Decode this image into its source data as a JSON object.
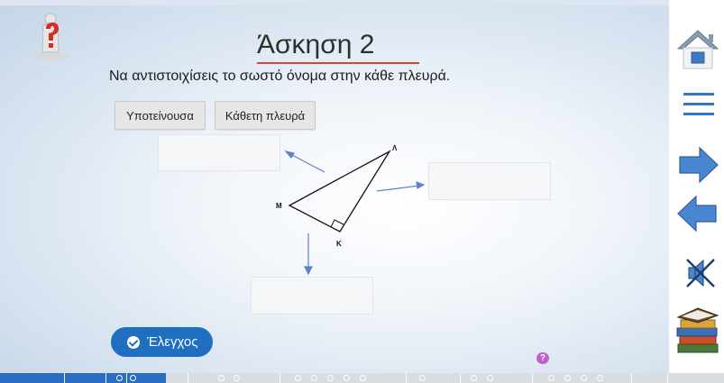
{
  "exercise": {
    "title": "Άσκηση 2",
    "instruction": "Να αντιστοιχίσεις το σωστό όνομα στην κάθε πλευρά."
  },
  "tiles": [
    {
      "label": "Υποτείνουσα"
    },
    {
      "label": "Κάθετη πλευρά"
    }
  ],
  "triangle": {
    "vertex_top": "Λ",
    "vertex_left": "Μ",
    "vertex_bottom": "Κ"
  },
  "check_button": {
    "label": "Έλεγχος"
  },
  "help_bubble": "?",
  "sidebar": [
    "home-icon",
    "menu-icon",
    "next-arrow-icon",
    "prev-arrow-icon",
    "mute-speaker-icon",
    "books-icon"
  ],
  "colors": {
    "accent": "#1e6fbf",
    "title_underline": "#d9443a",
    "arrow": "#5b84c4",
    "progress": "#2a6dc4"
  }
}
